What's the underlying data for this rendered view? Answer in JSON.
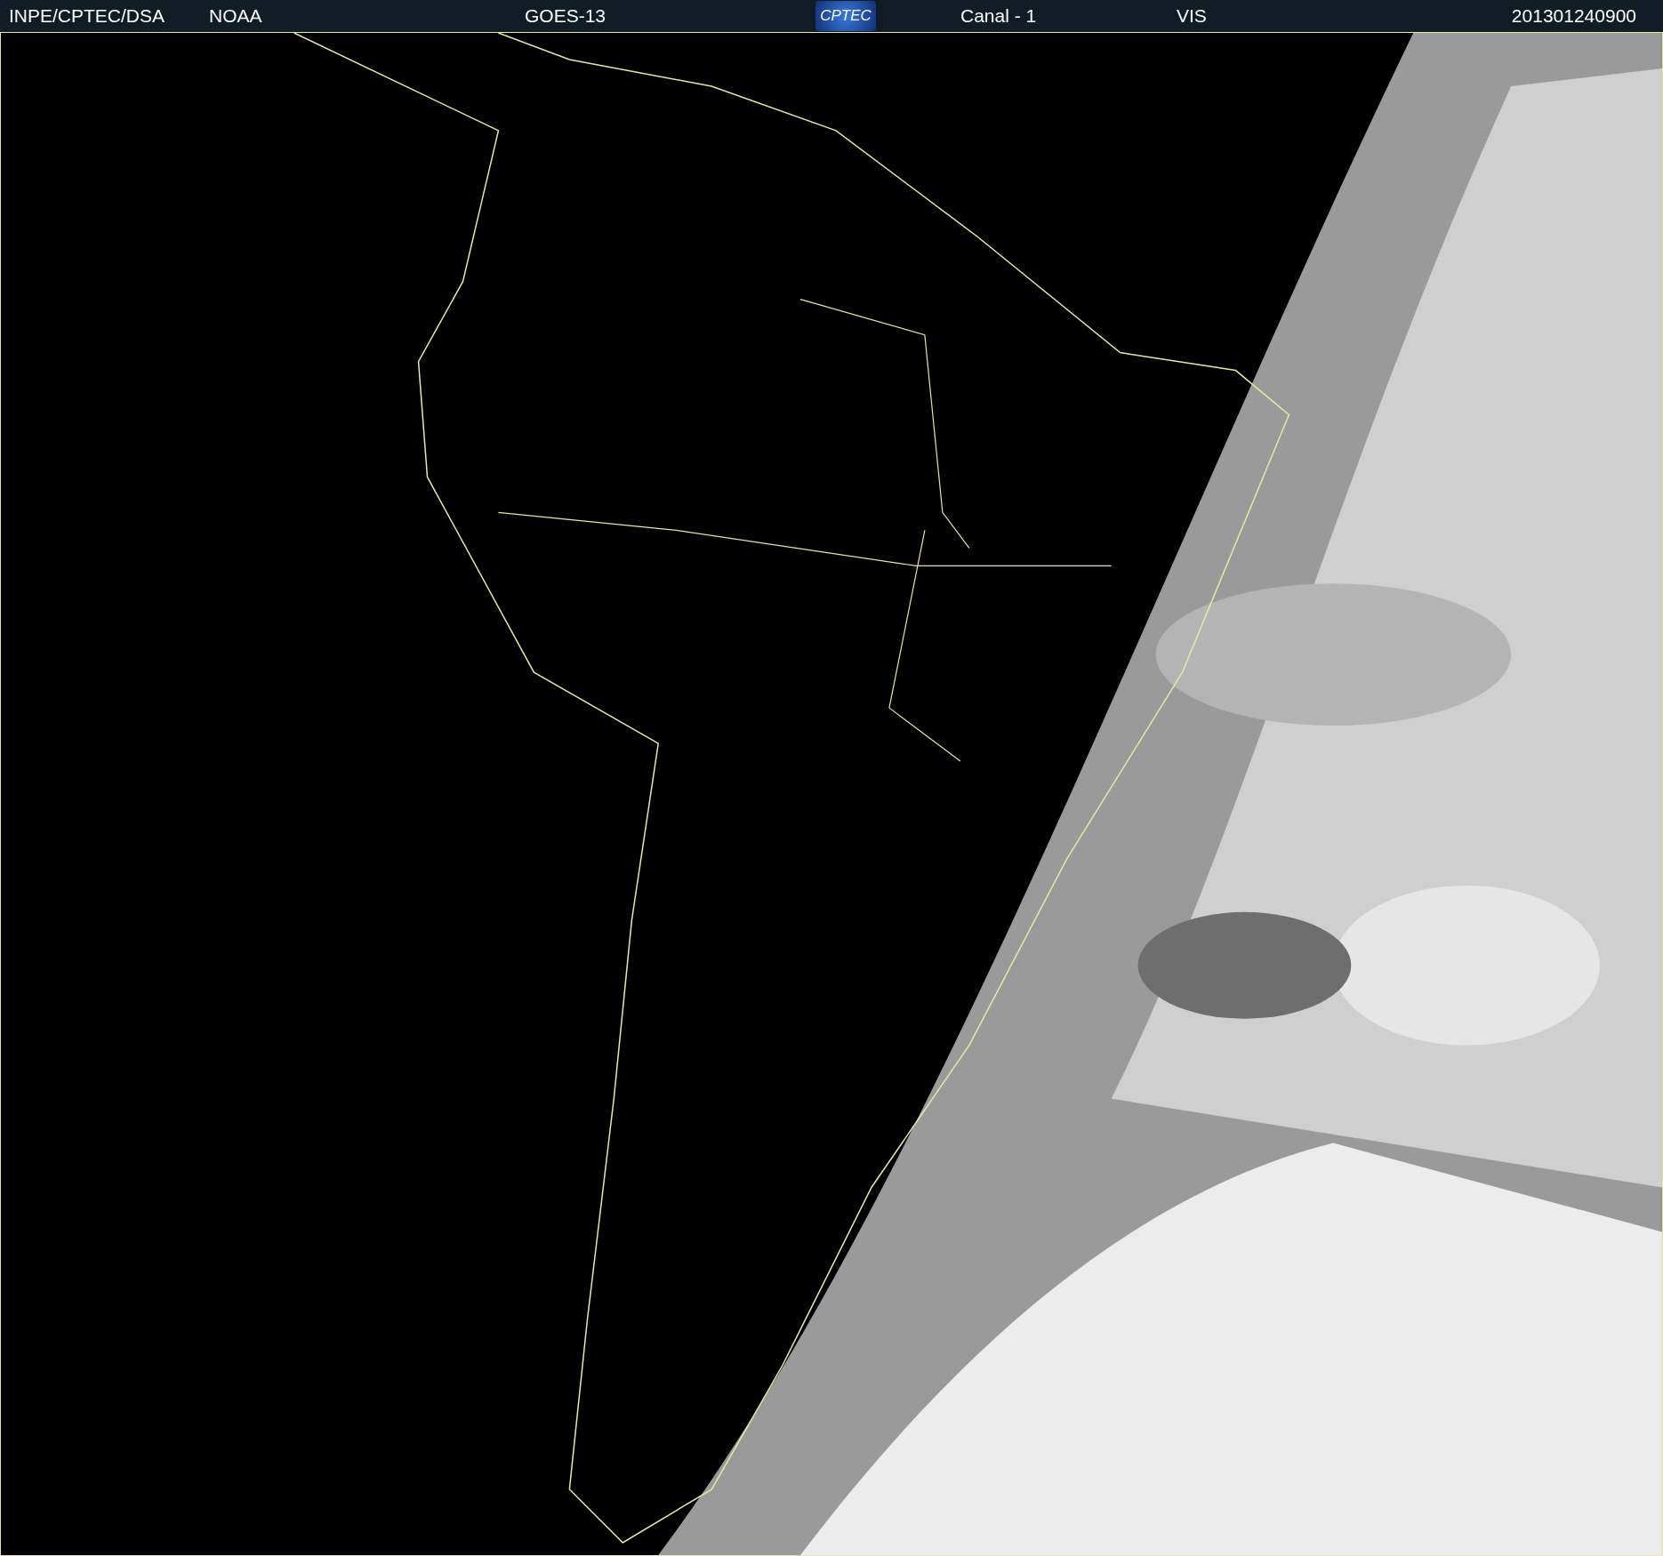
{
  "header": {
    "labels": [
      "INPE/CPTEC/DSA",
      "NOAA",
      "GOES-13"
    ],
    "logo": "CPTEC",
    "channel": "Canal - 1",
    "band": "VIS",
    "timestamp": "201301240900"
  }
}
